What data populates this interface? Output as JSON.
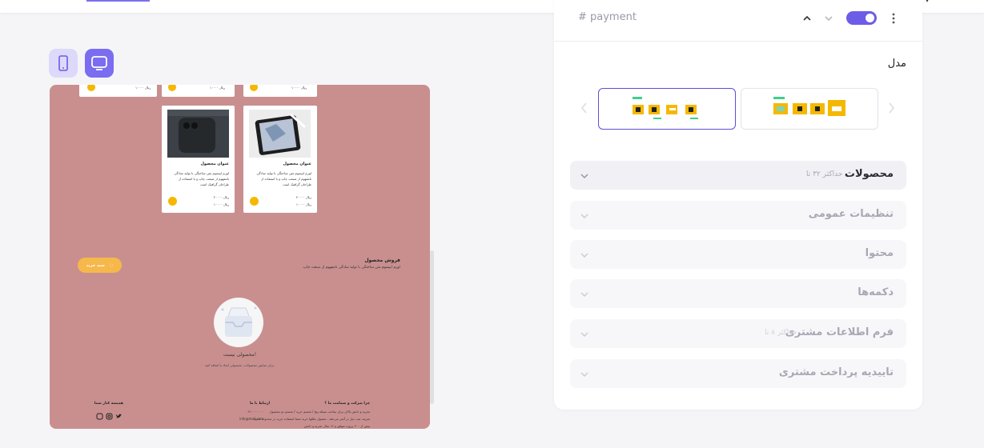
{
  "header": {
    "section_id": "# payment"
  },
  "settings": {
    "model_label": "مدل",
    "sections": [
      {
        "label": "محصولات",
        "note": "حداکثر ۳۲ تا"
      },
      {
        "label": "تنظیمات عمومی",
        "note": ""
      },
      {
        "label": "محتوا",
        "note": ""
      },
      {
        "label": "دکمه‌ها",
        "note": ""
      },
      {
        "label": "فرم اطلاعات مشتری",
        "note": "حداکثر ۸ تا"
      },
      {
        "label": "تاییدیه پرداخت مشتری",
        "note": ""
      }
    ]
  },
  "preview": {
    "cards": [
      {
        "title": "عنوان محصول",
        "desc": "لورم ایپسوم متن ساختگی با تولید سادگی نامفهوم از صنعت چاپ و با استفاده از طراحان گرافیک است",
        "old_price": "۲۰۰۰۰ ریال",
        "new_price": "۱۰۰۰۰ ریال"
      },
      {
        "title": "عنوان محصول",
        "desc": "لورم ایپسوم متن ساختگی با تولید سادگی نامفهوم از صنعت چاپ و با استفاده از طراحان گرافیک است",
        "old_price": "۲۰۰۰۰ ریال",
        "new_price": "۱۰۰۰۰ ریال"
      }
    ],
    "top_prices": [
      "۱۰۰۰۰ ریال",
      "۱۰۰۰۰ ریال"
    ],
    "sale_title": "فروش محصول",
    "sale_desc": "لورم ایپسوم متن ساختگی با تولید سادگی نامفهوم از صنعت چاپ.",
    "buy_button": "سبد خرید",
    "empty_title": "محصولی نیست!",
    "empty_sub": "برای نمایش محصولات، محصولی ایجاد یا اضافه کنید.",
    "footer": {
      "why_title": "چرا شرکت و شمامت ما ؟",
      "why_lines": [
        "تجربه و دانش بالای برای ساخت شبکه پیج / تجسم خرید / تجسم دو محصول",
        "تعریف ثبت نیاز در آنجر می‌دهد ، معمول ملکها خرید شما استفاده خرید در محدوده حدود",
        "بیش از ۲۰۰ پروژه موفق و ۱۲ سال تجربه و دانش"
      ],
      "contact_title": "ارتباط با ما",
      "contact_lines": [
        "۰۲۱۰۰۰۰۰۰۰",
        "info@mail.com"
      ],
      "partners_title": "همیشه کنار شما"
    }
  },
  "colors": {
    "accent": "#6c5ce7",
    "preview_bg": "#c98f8f",
    "cart_yellow": "#f5b800"
  }
}
